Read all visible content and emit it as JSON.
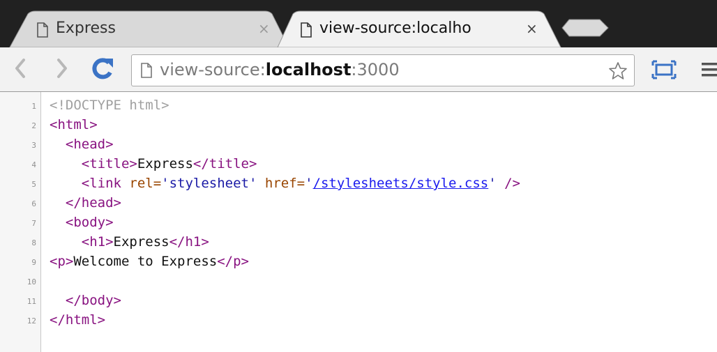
{
  "tabs": [
    {
      "label": "Express",
      "close": "×",
      "active": false
    },
    {
      "label": "view-source:localho",
      "close": "×",
      "active": true
    }
  ],
  "toolbar": {
    "url_scheme": "view-source:",
    "url_host": "localhost",
    "url_port": ":3000"
  },
  "source": {
    "line_numbers": [
      "1",
      "2",
      "3",
      "4",
      "5",
      "6",
      "7",
      "8",
      "9",
      "10",
      "11",
      "12"
    ],
    "line1": "<!DOCTYPE html>",
    "line2": "<html>",
    "line3": "<head>",
    "line4_open": "<title>",
    "line4_text": "Express",
    "line4_close": "</title>",
    "line5_tag": "<link",
    "line5_attr1": " rel=",
    "line5_val1": "'stylesheet'",
    "line5_attr2": " href=",
    "line5_q1": "'",
    "line5_href": "/stylesheets/style.css",
    "line5_q2": "'",
    "line5_end": " />",
    "line6": "</head>",
    "line7": "<body>",
    "line8_open": "<h1>",
    "line8_text": "Express",
    "line8_close": "</h1>",
    "line9_open": "<p>",
    "line9_text": "Welcome to Express",
    "line9_close": "</p>",
    "line11": "</body>",
    "line12": "</html>"
  },
  "colors": {
    "tag": "#881280",
    "attribute": "#994500",
    "value": "#1a1aa6",
    "link": "#1a1aee",
    "doctype": "#a0a0a0"
  }
}
